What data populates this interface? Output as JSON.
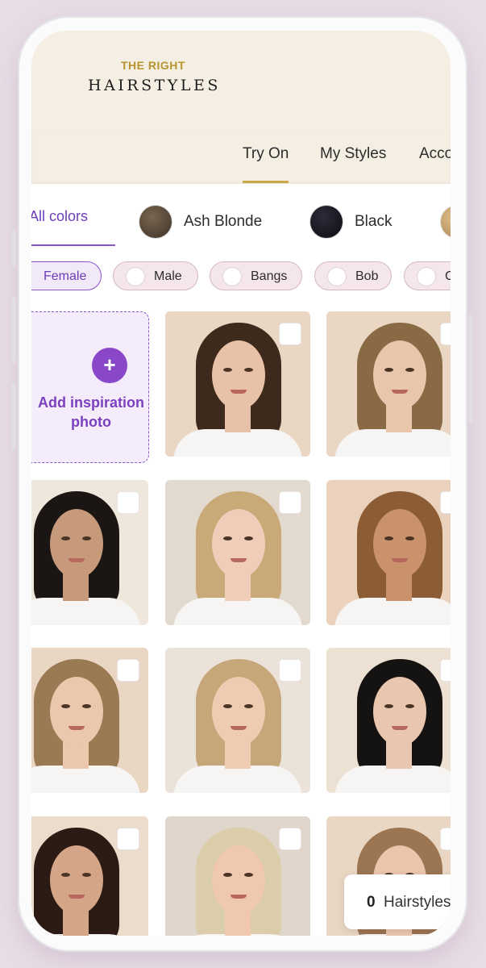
{
  "app": {
    "logo_top": "THE RIGHT",
    "logo_bottom": "HAIRSTYLES"
  },
  "nav": {
    "tabs": [
      {
        "label": "Try On",
        "active": true
      },
      {
        "label": "My Styles",
        "active": false
      },
      {
        "label": "Acco",
        "active": false
      }
    ]
  },
  "colors": {
    "active_label": "All colors",
    "items": [
      {
        "label": "Ash Blonde",
        "swatch": "#5a4a3c"
      },
      {
        "label": "Black",
        "swatch": "#15151e"
      },
      {
        "label": "",
        "swatch": "#c9a56a"
      }
    ]
  },
  "filters": [
    {
      "label": "Female",
      "active": true
    },
    {
      "label": "Male",
      "active": false
    },
    {
      "label": "Bangs",
      "active": false
    },
    {
      "label": "Bob",
      "active": false
    },
    {
      "label": "C",
      "active": false
    }
  ],
  "inspiration": {
    "plus": "+",
    "label_line1": "Add inspiration",
    "label_line2": "photo"
  },
  "grid": {
    "tiles": [
      {
        "name": "brunette-curtain-bangs",
        "bg": "#ead7c3",
        "hair": "#3e2a1c",
        "skin": "#e8c2a8"
      },
      {
        "name": "blonde-wavy-lob",
        "bg": "#ead7c3",
        "hair": "#8a6a45",
        "skin": "#e9c5ac"
      },
      {
        "name": "black-curly-bob",
        "bg": "#efe6dc",
        "hair": "#1b1613",
        "skin": "#c79a7c"
      },
      {
        "name": "blonde-shaggy-bob",
        "bg": "#e2d9cf",
        "hair": "#c9a977",
        "skin": "#f0cdb8"
      },
      {
        "name": "caramel-long-curls",
        "bg": "#ead2bd",
        "hair": "#8c5d34",
        "skin": "#c9916c"
      },
      {
        "name": "blonde-straight-bob",
        "bg": "#ead7c3",
        "hair": "#9a7a52",
        "skin": "#eac7ad"
      },
      {
        "name": "long-layered-blonde",
        "bg": "#ebe3da",
        "hair": "#c6a77a",
        "skin": "#efcbb2"
      },
      {
        "name": "black-bob-bangs",
        "bg": "#ece1d3",
        "hair": "#151312",
        "skin": "#e9c6ae"
      },
      {
        "name": "dark-curly-fringe",
        "bg": "#ecdccb",
        "hair": "#2b1b14",
        "skin": "#d5a587"
      },
      {
        "name": "platinum-pixie",
        "bg": "#e0d6cc",
        "hair": "#dccdaa",
        "skin": "#f0c8b0"
      },
      {
        "name": "light-brown-center-part",
        "bg": "#ead7c3",
        "hair": "#9c7553",
        "skin": "#ebc6ad"
      }
    ]
  },
  "counter": {
    "count": "0",
    "label": "Hairstyles"
  }
}
